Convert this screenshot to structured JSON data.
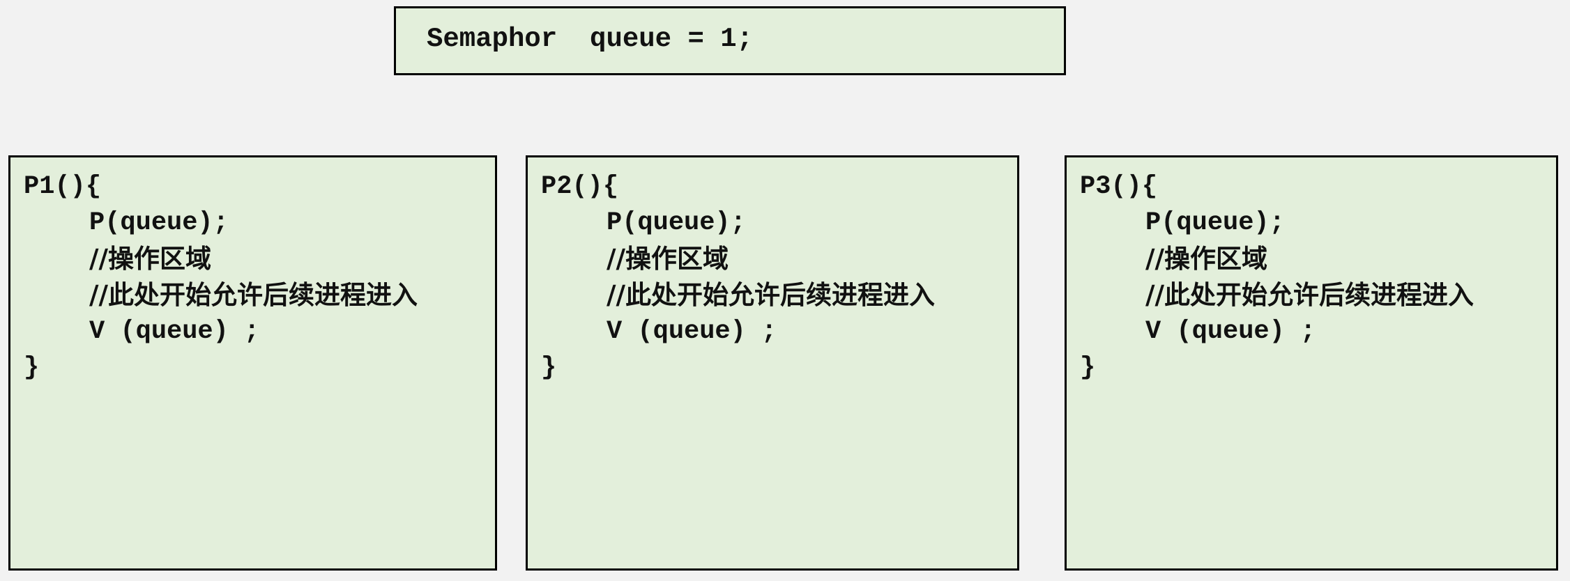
{
  "semaphore": {
    "declaration": "Semaphor  queue = 1;"
  },
  "processes": [
    {
      "header": "P1(){",
      "p_call": "P(queue);",
      "comment_1": "//操作区域",
      "comment_2": "//此处开始允许后续进程进入",
      "v_call": "V (queue) ;",
      "closing": "}"
    },
    {
      "header": "P2(){",
      "p_call": "P(queue);",
      "comment_1": "//操作区域",
      "comment_2": "//此处开始允许后续进程进入",
      "v_call": "V (queue) ;",
      "closing": "}"
    },
    {
      "header": "P3(){",
      "p_call": "P(queue);",
      "comment_1": "//操作区域",
      "comment_2": "//此处开始允许后续进程进入",
      "v_call": "V (queue) ;",
      "closing": "}"
    }
  ],
  "colors": {
    "page_background": "#f2f2f2",
    "box_fill": "#e3efdb",
    "box_border": "#000000",
    "text": "#111111"
  }
}
